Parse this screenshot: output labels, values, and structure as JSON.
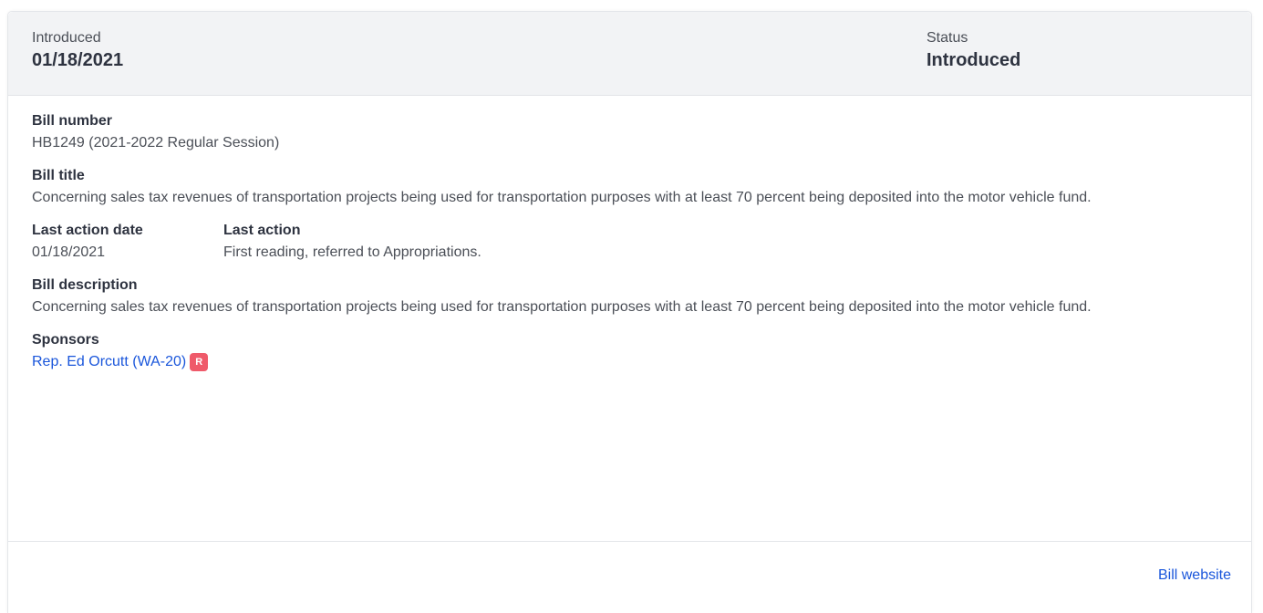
{
  "header": {
    "introduced_label": "Introduced",
    "introduced_date": "01/18/2021",
    "status_label": "Status",
    "status_value": "Introduced"
  },
  "bill_number": {
    "label": "Bill number",
    "value": "HB1249 (2021-2022 Regular Session)"
  },
  "bill_title": {
    "label": "Bill title",
    "value": "Concerning sales tax revenues of transportation projects being used for transportation purposes with at least 70 percent being deposited into the motor vehicle fund."
  },
  "last_action_date": {
    "label": "Last action date",
    "value": "01/18/2021"
  },
  "last_action": {
    "label": "Last action",
    "value": "First reading, referred to Appropriations."
  },
  "bill_description": {
    "label": "Bill description",
    "value": "Concerning sales tax revenues of transportation projects being used for transportation purposes with at least 70 percent being deposited into the motor vehicle fund."
  },
  "sponsors": {
    "label": "Sponsors",
    "items": [
      {
        "name": "Rep. Ed Orcutt (WA-20)",
        "party": "R",
        "party_color": "#ef5a6a"
      }
    ]
  },
  "footer": {
    "bill_website_label": "Bill website"
  },
  "colors": {
    "link": "#1a56db",
    "header_bg": "#f2f3f5"
  }
}
